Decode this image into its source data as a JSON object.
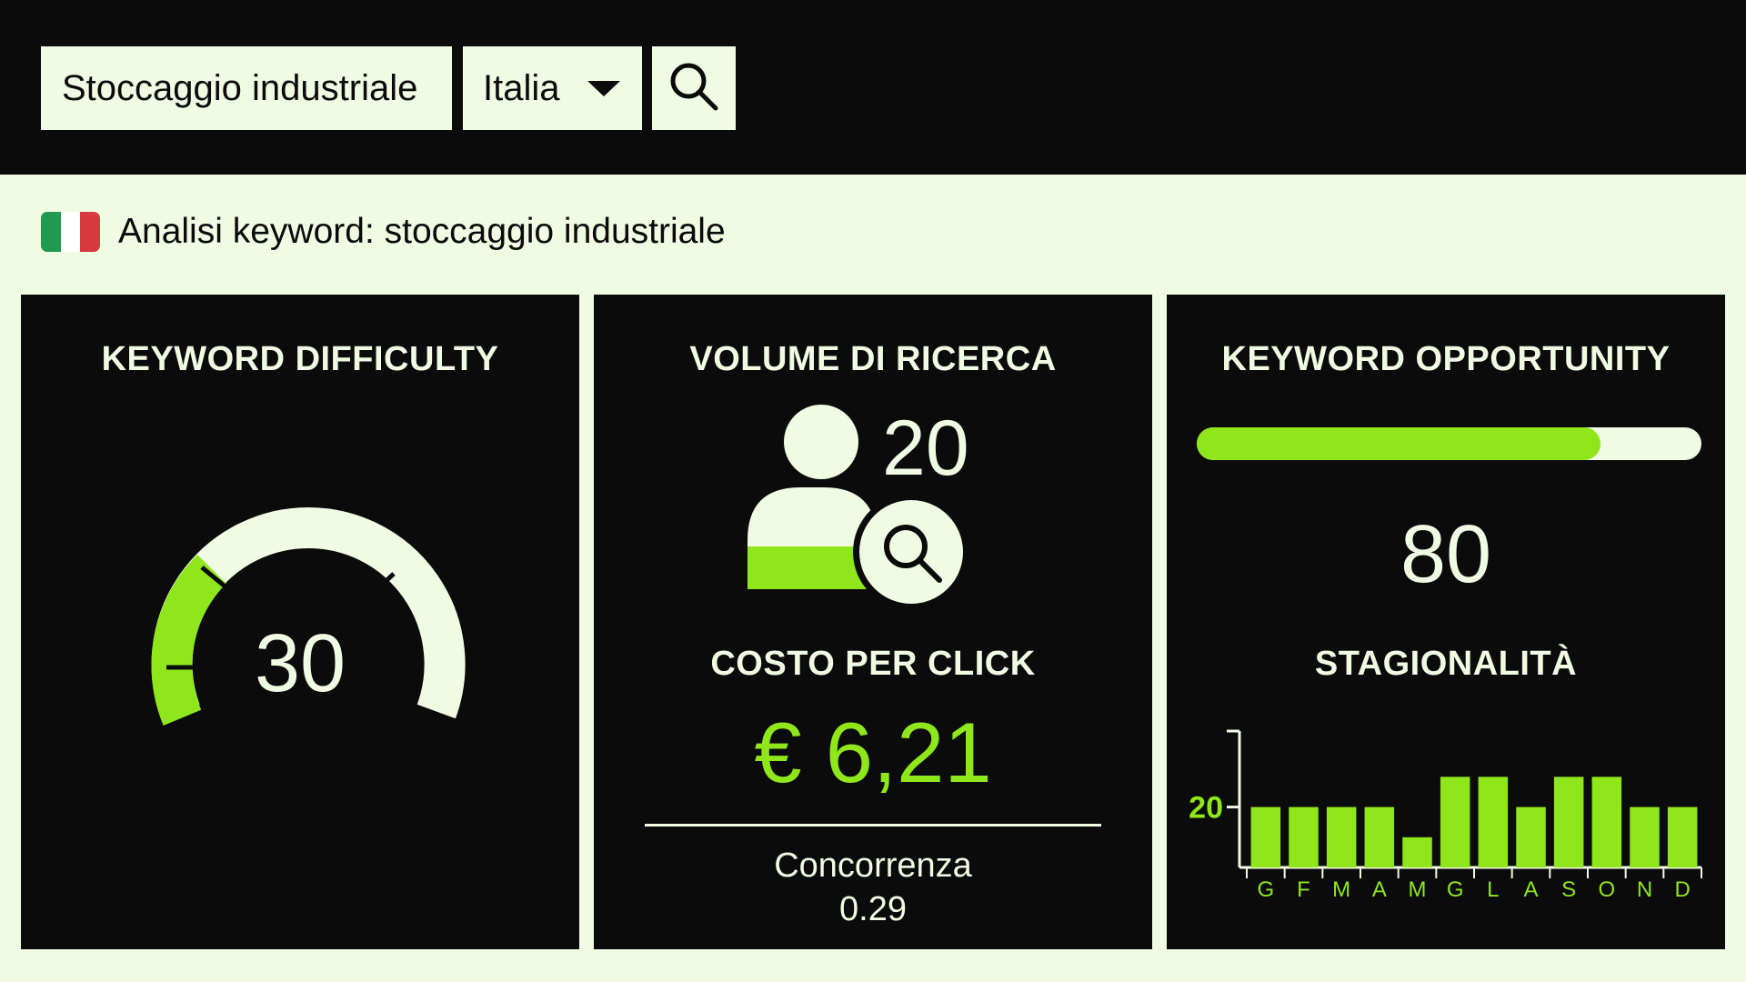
{
  "search": {
    "query": "Stoccaggio industriale",
    "country": "Italia",
    "search_icon": "search-icon",
    "dropdown_icon": "caret-down-icon"
  },
  "analysis": {
    "flag_icon": "italy-flag-icon",
    "flag_colors": [
      "#009246",
      "#ffffff",
      "#ce2b37"
    ],
    "title": "Analisi keyword: stoccaggio industriale"
  },
  "colors": {
    "background": "#f0fbe3",
    "panel": "#0b0b0b",
    "accent": "#8fe61a",
    "text_light": "#f0fbe3"
  },
  "difficulty": {
    "title": "KEYWORD DIFFICULTY",
    "value": "30",
    "level": 30,
    "max": 100
  },
  "volume": {
    "title": "VOLUME DI RICERCA",
    "value": "20",
    "icon": "user-search-icon"
  },
  "cpc": {
    "title": "COSTO PER CLICK",
    "value": "€ 6,21",
    "competition_label": "Concorrenza",
    "competition_value": "0.29"
  },
  "opportunity": {
    "title": "KEYWORD OPPORTUNITY",
    "value": "80",
    "level": 80,
    "max": 100
  },
  "seasonality": {
    "title": "STAGIONALITÀ",
    "chart_data": {
      "type": "bar",
      "categories": [
        "G",
        "F",
        "M",
        "A",
        "M",
        "G",
        "L",
        "A",
        "S",
        "O",
        "N",
        "D"
      ],
      "values": [
        20,
        20,
        20,
        20,
        10,
        30,
        30,
        20,
        30,
        30,
        20,
        20
      ],
      "yticks": [
        "20"
      ],
      "ylim": [
        0,
        50
      ],
      "xlabel": "",
      "ylabel": "",
      "title": ""
    }
  }
}
